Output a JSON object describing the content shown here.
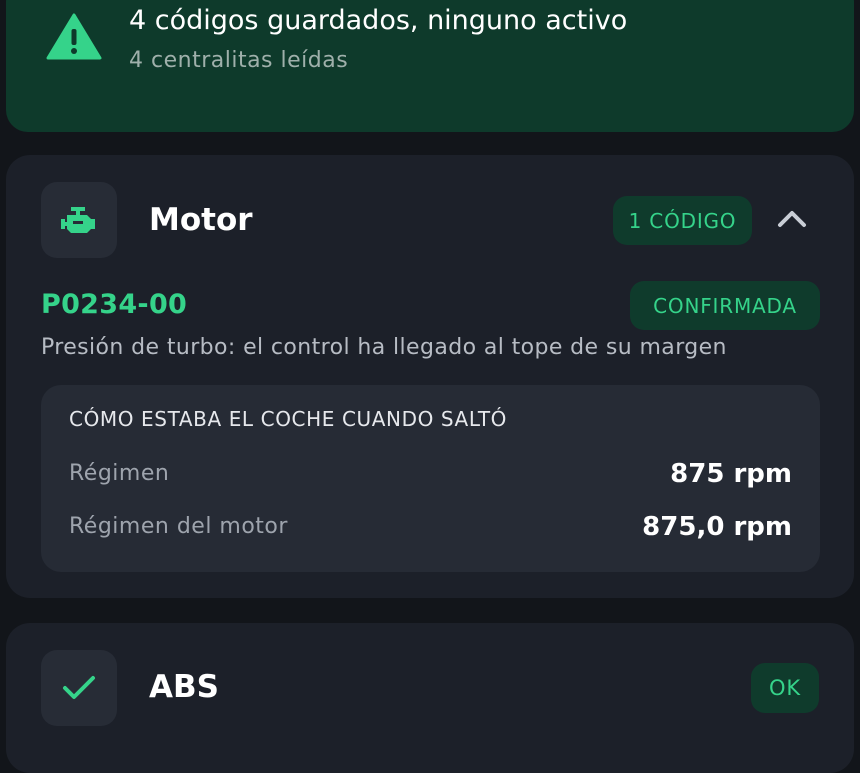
{
  "banner": {
    "icon": "warning-triangle-icon",
    "title": "4 códigos guardados, ninguno activo",
    "subtitle": "4 centralitas leídas"
  },
  "modules": [
    {
      "name": "Motor",
      "icon": "engine-icon",
      "badge": "1 CÓDIGO",
      "expanded": true,
      "toggle_icon": "chevron-up-icon",
      "codes": [
        {
          "code": "P0234-00",
          "status": "CONFIRMADA",
          "description": "Presión de turbo: el control ha llegado al tope de su margen",
          "freeze_frame": {
            "title": "CÓMO ESTABA EL COCHE CUANDO SALTÓ",
            "rows": [
              {
                "label": "Régimen",
                "value": "875 rpm"
              },
              {
                "label": "Régimen del motor",
                "value": "875,0 rpm"
              }
            ]
          }
        }
      ]
    },
    {
      "name": "ABS",
      "icon": "checkmark-icon",
      "badge": "OK"
    }
  ],
  "colors": {
    "accent": "#35d38a",
    "banner_bg": "#0e3a2b",
    "card_bg": "#1c2029",
    "panel_bg": "#262b35",
    "page_bg": "#12151a"
  }
}
